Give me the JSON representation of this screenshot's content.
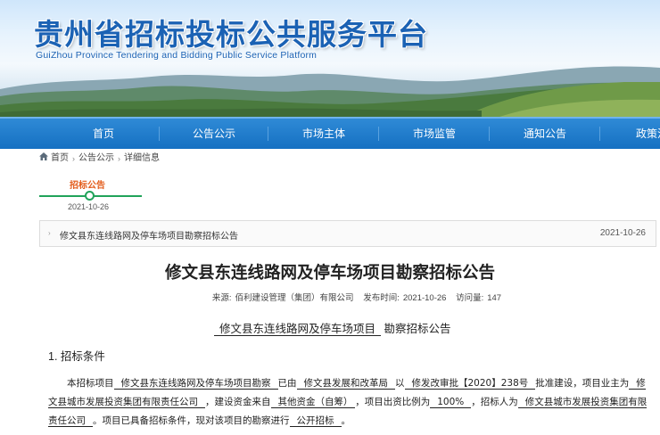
{
  "header": {
    "title": "贵州省招标投标公共服务平台",
    "subtitle": "GuiZhou Province Tendering and Bidding Public Service Platform"
  },
  "nav": {
    "items": [
      "首页",
      "公告公示",
      "市场主体",
      "市场监管",
      "通知公告",
      "政策法"
    ]
  },
  "breadcrumb": {
    "home": "首页",
    "level2": "公告公示",
    "level3": "详细信息",
    "separator": "›"
  },
  "timeline": {
    "label": "招标公告",
    "date": "2021-10-26"
  },
  "related": {
    "arrow": "›",
    "title": "修文县东连线路网及停车场项目勘察招标公告",
    "date": "2021-10-26"
  },
  "article": {
    "title": "修文县东连线路网及停车场项目勘察招标公告",
    "source_label": "来源:",
    "source": "佰利建设管理（集团）有限公司",
    "time_label": "发布时间:",
    "time": "2021-10-26",
    "visits_label": "访问量:",
    "visits": "147",
    "sub_project": "修文县东连线路网及停车场项目",
    "sub_suffix": "勘察招标公告",
    "section1": "1. 招标条件",
    "p1_a": "本招标项目",
    "p1_project": "修文县东连线路网及停车场项目勘察",
    "p1_b": "已由",
    "p1_authority": "修文县发展和改革局",
    "p1_c": "以",
    "p1_approval": "修发改审批【2020】238号",
    "p1_d": "批准建设，项目业主为",
    "p1_owner": "修文县城市发展投资集团有限责任公司",
    "p1_e": "，建设资金来自",
    "p1_funds": "其他资金（自筹）",
    "p1_f": "，项目出资比例为",
    "p1_ratio": "100%",
    "p1_g": "，招标人为",
    "p1_tenderer": "修文县城市发展投资集团有限责任公司",
    "p1_h": "。项目已具备招标条件，现对该项目的勘察进行",
    "p1_method": "公开招标",
    "p1_i": "。"
  },
  "colors": {
    "brand_blue": "#1b62b4",
    "nav_blue": "#1570c2",
    "accent_orange": "#e35d1c",
    "timeline_green": "#21a35a"
  }
}
